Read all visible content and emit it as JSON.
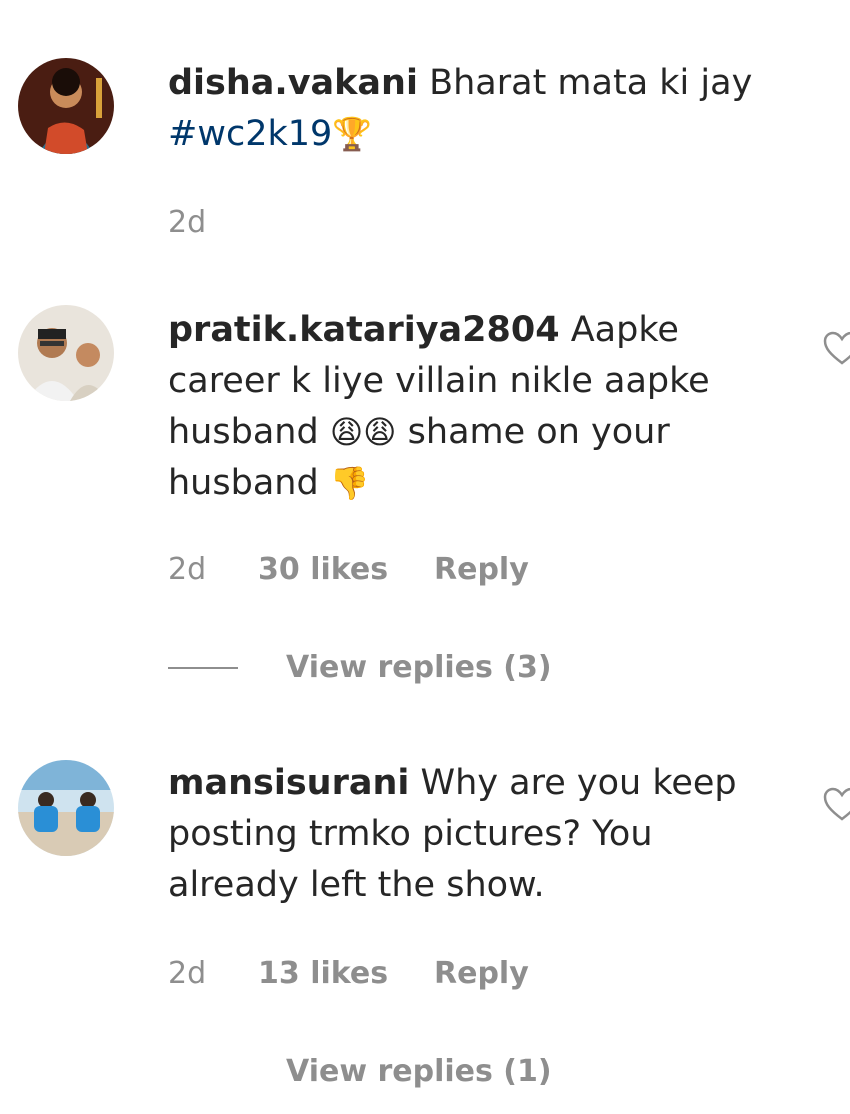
{
  "comments": [
    {
      "username": "disha.vakani",
      "text": "Bharat mata ki jay",
      "hashtag": "#wc2k19",
      "hashtag_emoji": "🏆",
      "time": "2d"
    },
    {
      "username": "pratik.katariya2804",
      "text_line1": "Aapke",
      "text_line2": "career k liye villain nikle aapke",
      "text_line3_a": "husband",
      "emoji_a": "😩😩",
      "text_line3_b": "shame on your",
      "text_line4": "husband",
      "emoji_b": "👎",
      "time": "2d",
      "likes": "30 likes",
      "reply": "Reply",
      "view_replies": "View replies (3)"
    },
    {
      "username": "mansisurani",
      "text_line1": "Why are you keep",
      "text_line2": "posting trmko pictures? You",
      "text_line3": "already left the show.",
      "time": "2d",
      "likes": "13 likes",
      "reply": "Reply",
      "view_replies": "View replies (1)"
    }
  ],
  "icons": {
    "like": "heart-outline-icon"
  }
}
